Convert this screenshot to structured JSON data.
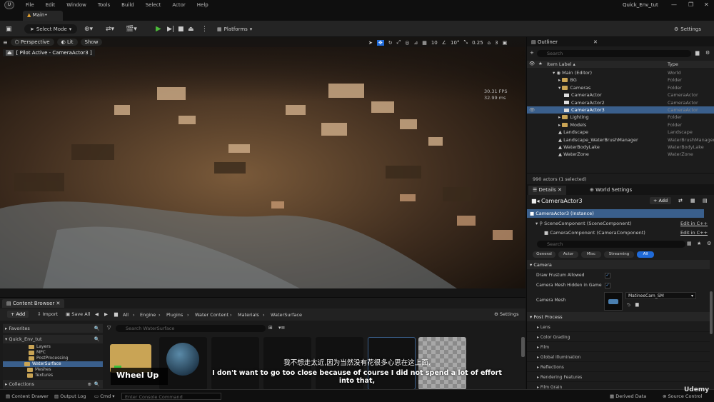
{
  "menubar": {
    "items": [
      "File",
      "Edit",
      "Window",
      "Tools",
      "Build",
      "Select",
      "Actor",
      "Help"
    ],
    "project": "Quick_Env_tut",
    "tab": "Main•"
  },
  "toolbar": {
    "select_mode": "Select Mode",
    "platforms": "Platforms",
    "settings": "Settings"
  },
  "viewport": {
    "perspective": "Perspective",
    "lit": "Lit",
    "show": "Show",
    "pilot": "[ Pilot Active - CameraActor3 ]",
    "fps": "30.31 FPS",
    "ms": "32.99 ms",
    "grid": "10",
    "angle": "10°",
    "scale": "0.25",
    "speed": "3"
  },
  "outliner": {
    "tab": "Outliner",
    "search_placeholder": "Search",
    "col_label": "Item Label ▴",
    "col_type": "Type",
    "rows": [
      {
        "label": "Main (Editor)",
        "type": "World",
        "indent": 36,
        "kind": "world"
      },
      {
        "label": "BG",
        "type": "Folder",
        "indent": 44,
        "kind": "folder"
      },
      {
        "label": "Cameras",
        "type": "Folder",
        "indent": 44,
        "kind": "folder"
      },
      {
        "label": "CameraActor",
        "type": "CameraActor",
        "indent": 52,
        "kind": "cam"
      },
      {
        "label": "CameraActor2",
        "type": "CameraActor",
        "indent": 52,
        "kind": "cam"
      },
      {
        "label": "CameraActor3",
        "type": "CameraActor",
        "indent": 52,
        "kind": "cam",
        "selected": true
      },
      {
        "label": "Lighting",
        "type": "Folder",
        "indent": 44,
        "kind": "folder"
      },
      {
        "label": "Models",
        "type": "Folder",
        "indent": 44,
        "kind": "folder"
      },
      {
        "label": "Landscape",
        "type": "Landscape",
        "indent": 44,
        "kind": "item"
      },
      {
        "label": "Landscape_WaterBrushManager",
        "type": "WaterBrushManager",
        "indent": 44,
        "kind": "item"
      },
      {
        "label": "WaterBodyLake",
        "type": "WaterBodyLake",
        "indent": 44,
        "kind": "item"
      },
      {
        "label": "WaterZone",
        "type": "WaterZone",
        "indent": 44,
        "kind": "item"
      }
    ],
    "footer": "990 actors (1 selected)"
  },
  "details": {
    "tab": "Details",
    "tab2": "World Settings",
    "actor": "CameraActor3",
    "add": "+ Add",
    "instance": "CameraActor3 (Instance)",
    "comp1": "SceneComponent (SceneComponent)",
    "comp2": "CameraComponent (CameraComponent)",
    "edit_cpp": "Edit in C++",
    "search_placeholder": "Search",
    "filters": [
      "General",
      "Actor",
      "Misc",
      "Streaming",
      "All"
    ],
    "camera_section": "Camera",
    "draw_frustum": "Draw Frustum Allowed",
    "mesh_hidden": "Camera Mesh Hidden in Game",
    "camera_mesh": "Camera Mesh",
    "mesh_value": "MatineeCam_SM",
    "post_process": "Post Process",
    "categories": [
      "Lens",
      "Color Grading",
      "Film",
      "Global Illumination",
      "Reflections",
      "Rendering Features",
      "Film Grain"
    ]
  },
  "content_browser": {
    "tab": "Content Browser",
    "add": "+ Add",
    "import": "Import",
    "save_all": "Save All",
    "crumbs": [
      "All",
      "Engine",
      "Plugins",
      "Water Content",
      "Materials",
      "WaterSurface"
    ],
    "settings": "Settings",
    "favorites": "Favorites",
    "project": "Quick_Env_tut",
    "tree": [
      "Layers",
      "MPC",
      "PostProcessing",
      "WaterSurface",
      "Meshes",
      "Textures"
    ],
    "collections": "Collections",
    "search_placeholder": "Search WaterSurface"
  },
  "statusbar": {
    "content_drawer": "Content Drawer",
    "output_log": "Output Log",
    "cmd": "Cmd",
    "console_placeholder": "Enter Console Command",
    "derived": "Derived Data",
    "source": "Source Control"
  },
  "overlay": {
    "sub_cn": "我不想走太近,因为当然没有花很多心思在这上面,",
    "sub_en": "I don't want to go too close because of course I did not spend a lot of effort into that,",
    "wheel": "Wheel Up",
    "watermark": "Udemy"
  }
}
